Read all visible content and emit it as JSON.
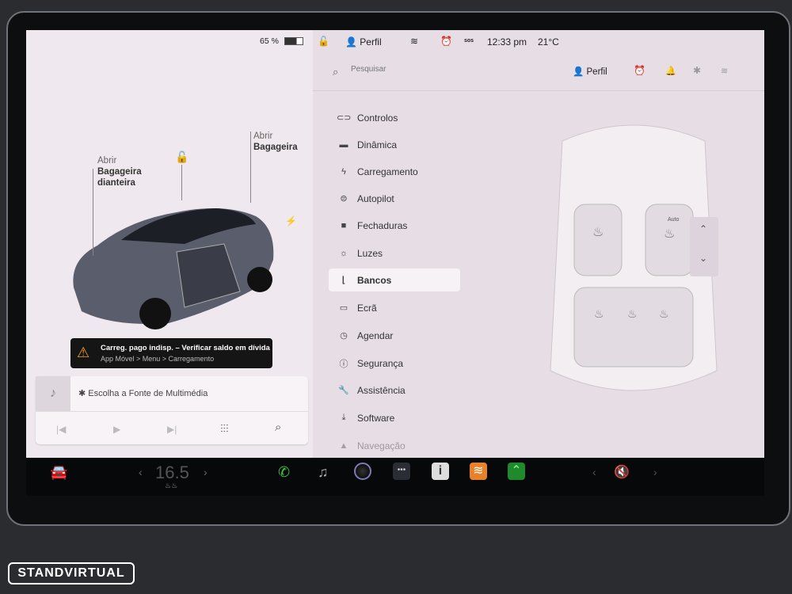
{
  "status": {
    "battery": "65 %",
    "profile": "Perfil",
    "time": "12:33 pm",
    "temp": "21°C",
    "sos": "sos"
  },
  "header": {
    "search_placeholder": "Pesquisar",
    "profile": "Perfil"
  },
  "car": {
    "frunk_open": "Abrir",
    "frunk_name": "Bagageira dianteira",
    "trunk_open": "Abrir",
    "trunk_name": "Bagageira"
  },
  "alert": {
    "title": "Carreg. pago indisp. – Verificar saldo em dívida",
    "subtitle": "App Móvel > Menu > Carregamento"
  },
  "media": {
    "source": "Escolha a Fonte de Multimédia"
  },
  "menu": [
    {
      "label": "Controlos",
      "icon": "toggle-icon",
      "glyph": "⊂⊃"
    },
    {
      "label": "Dinâmica",
      "icon": "car-icon",
      "glyph": "🚘"
    },
    {
      "label": "Carregamento",
      "icon": "bolt-icon",
      "glyph": "⚡"
    },
    {
      "label": "Autopilot",
      "icon": "steering-wheel-icon",
      "glyph": "⊜"
    },
    {
      "label": "Fechaduras",
      "icon": "lock-icon",
      "glyph": "🔒"
    },
    {
      "label": "Luzes",
      "icon": "sun-icon",
      "glyph": "☼"
    },
    {
      "label": "Bancos",
      "icon": "seat-icon",
      "glyph": "⌊"
    },
    {
      "label": "Ecrã",
      "icon": "display-icon",
      "glyph": "▭"
    },
    {
      "label": "Agendar",
      "icon": "alarm-icon",
      "glyph": "⏰"
    },
    {
      "label": "Segurança",
      "icon": "info-circle-icon",
      "glyph": "ⓘ"
    },
    {
      "label": "Assistência",
      "icon": "wrench-icon",
      "glyph": "🔧"
    },
    {
      "label": "Software",
      "icon": "download-icon",
      "glyph": "⤓"
    },
    {
      "label": "Navegação",
      "icon": "navigation-icon",
      "glyph": "▲"
    }
  ],
  "seats": {
    "auto": "Auto"
  },
  "taskbar": {
    "temperature": "16.5"
  },
  "watermark": "STANDVIRTUAL",
  "colors": {
    "accent_orange": "#e8822a",
    "phone_green": "#3ec93e"
  }
}
